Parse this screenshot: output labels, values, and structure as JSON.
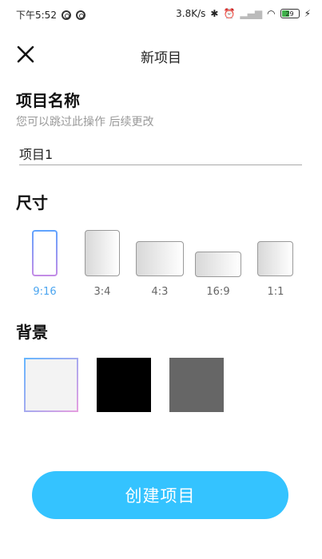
{
  "status_bar": {
    "time": "下午5:52",
    "network_speed": "3.8K/s",
    "battery": "29"
  },
  "header": {
    "title": "新项目",
    "close_icon": "close-icon"
  },
  "project_name": {
    "heading": "项目名称",
    "hint": "您可以跳过此操作 后续更改",
    "value": "项目1"
  },
  "size": {
    "heading": "尺寸",
    "options": [
      {
        "label": "9:16",
        "selected": true
      },
      {
        "label": "3:4",
        "selected": false
      },
      {
        "label": "4:3",
        "selected": false
      },
      {
        "label": "16:9",
        "selected": false
      },
      {
        "label": "1:1",
        "selected": false
      }
    ]
  },
  "background": {
    "heading": "背景",
    "options": [
      {
        "name": "white",
        "color": "#f3f3f3",
        "selected": true
      },
      {
        "name": "black",
        "color": "#000000",
        "selected": false
      },
      {
        "name": "gray",
        "color": "#666666",
        "selected": false
      }
    ]
  },
  "actions": {
    "create_label": "创建项目"
  },
  "colors": {
    "accent": "#34c3ff",
    "selected_label": "#4ba5f0"
  }
}
